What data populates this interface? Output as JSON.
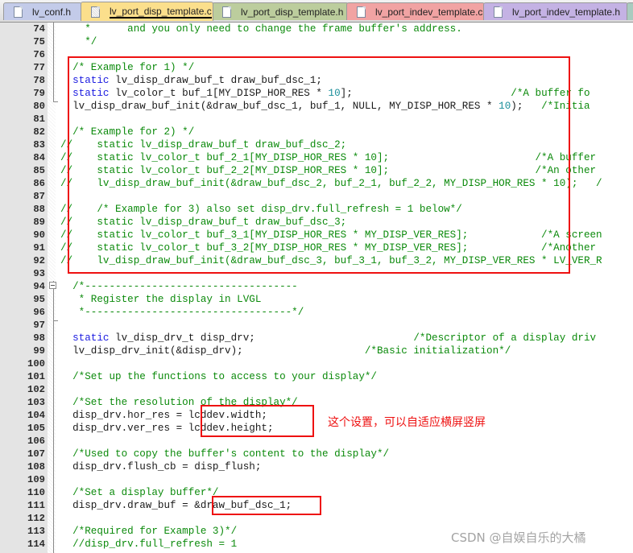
{
  "tabs": [
    {
      "label": "lv_conf.h",
      "active": false,
      "color": "#c3cbe9"
    },
    {
      "label": "lv_port_disp_template.c",
      "active": true,
      "color": "#fbdf8c"
    },
    {
      "label": "lv_port_disp_template.h",
      "active": false,
      "color": "#bccd9d"
    },
    {
      "label": "lv_port_indev_template.c",
      "active": false,
      "color": "#f1a3a3"
    },
    {
      "label": "lv_port_indev_template.h",
      "active": false,
      "color": "#c4b2e4"
    }
  ],
  "editor": {
    "lines": [
      {
        "n": "74",
        "segs": [
          [
            "cm",
            "    *      and you only need to change the frame buffer's address."
          ]
        ]
      },
      {
        "n": "75",
        "segs": [
          [
            "cm",
            "    */"
          ]
        ]
      },
      {
        "n": "76",
        "segs": []
      },
      {
        "n": "77",
        "segs": [
          [
            "cm",
            "  /* Example for 1) */"
          ]
        ]
      },
      {
        "n": "78",
        "segs": [
          [
            "kw",
            "  static"
          ],
          [
            "",
            " lv_disp_draw_buf_t draw_buf_dsc_1;"
          ]
        ]
      },
      {
        "n": "79",
        "segs": [
          [
            "kw",
            "  static"
          ],
          [
            "",
            " lv_color_t buf_1[MY_DISP_HOR_RES * "
          ],
          [
            "num",
            "10"
          ],
          [
            "",
            "];                          "
          ],
          [
            "cm",
            "/*A buffer fo"
          ]
        ]
      },
      {
        "n": "80",
        "segs": [
          [
            "",
            "  lv_disp_draw_buf_init(&draw_buf_dsc_1, buf_1, NULL, MY_DISP_HOR_RES * "
          ],
          [
            "num",
            "10"
          ],
          [
            "",
            ");   "
          ],
          [
            "cm",
            "/*Initia"
          ]
        ]
      },
      {
        "n": "81",
        "segs": []
      },
      {
        "n": "82",
        "segs": [
          [
            "cm",
            "  /* Example for 2) */"
          ]
        ]
      },
      {
        "n": "83",
        "segs": [
          [
            "disabled",
            "//    static lv_disp_draw_buf_t draw_buf_dsc_2;"
          ]
        ]
      },
      {
        "n": "84",
        "segs": [
          [
            "disabled",
            "//    static lv_color_t buf_2_1[MY_DISP_HOR_RES * 10];                        /*A buffer"
          ]
        ]
      },
      {
        "n": "85",
        "segs": [
          [
            "disabled",
            "//    static lv_color_t buf_2_2[MY_DISP_HOR_RES * 10];                        /*An other"
          ]
        ]
      },
      {
        "n": "86",
        "segs": [
          [
            "disabled",
            "//    lv_disp_draw_buf_init(&draw_buf_dsc_2, buf_2_1, buf_2_2, MY_DISP_HOR_RES * 10);   /"
          ]
        ]
      },
      {
        "n": "87",
        "segs": []
      },
      {
        "n": "88",
        "segs": [
          [
            "disabled",
            "//    /* Example for 3) also set disp_drv.full_refresh = 1 below*/"
          ]
        ]
      },
      {
        "n": "89",
        "segs": [
          [
            "disabled",
            "//    static lv_disp_draw_buf_t draw_buf_dsc_3;"
          ]
        ]
      },
      {
        "n": "90",
        "segs": [
          [
            "disabled",
            "//    static lv_color_t buf_3_1[MY_DISP_HOR_RES * MY_DISP_VER_RES];            /*A screen"
          ]
        ]
      },
      {
        "n": "91",
        "segs": [
          [
            "disabled",
            "//    static lv_color_t buf_3_2[MY_DISP_HOR_RES * MY_DISP_VER_RES];            /*Another"
          ]
        ]
      },
      {
        "n": "92",
        "segs": [
          [
            "disabled",
            "//    lv_disp_draw_buf_init(&draw_buf_dsc_3, buf_3_1, buf_3_2, MY_DISP_VER_RES * LV_VER_R"
          ]
        ]
      },
      {
        "n": "93",
        "segs": []
      },
      {
        "n": "94",
        "segs": [
          [
            "cm",
            "  /*-----------------------------------"
          ]
        ]
      },
      {
        "n": "95",
        "segs": [
          [
            "cm",
            "   * Register the display in LVGL"
          ]
        ]
      },
      {
        "n": "96",
        "segs": [
          [
            "cm",
            "   *----------------------------------*/"
          ]
        ]
      },
      {
        "n": "97",
        "segs": []
      },
      {
        "n": "98",
        "segs": [
          [
            "kw",
            "  static"
          ],
          [
            "",
            " lv_disp_drv_t disp_drv;                          "
          ],
          [
            "cm",
            "/*Descriptor of a display driv"
          ]
        ]
      },
      {
        "n": "99",
        "segs": [
          [
            "",
            "  lv_disp_drv_init(&disp_drv);                    "
          ],
          [
            "cm",
            "/*Basic initialization*/"
          ]
        ]
      },
      {
        "n": "100",
        "segs": []
      },
      {
        "n": "101",
        "segs": [
          [
            "cm",
            "  /*Set up the functions to access to your display*/"
          ]
        ]
      },
      {
        "n": "102",
        "segs": []
      },
      {
        "n": "103",
        "segs": [
          [
            "cm",
            "  /*Set the resolution of the display*/"
          ]
        ]
      },
      {
        "n": "104",
        "segs": [
          [
            "",
            "  disp_drv.hor_res = lcddev.width;"
          ]
        ]
      },
      {
        "n": "105",
        "segs": [
          [
            "",
            "  disp_drv.ver_res = lcddev.height;"
          ]
        ]
      },
      {
        "n": "106",
        "segs": []
      },
      {
        "n": "107",
        "segs": [
          [
            "cm",
            "  /*Used to copy the buffer's content to the display*/"
          ]
        ]
      },
      {
        "n": "108",
        "segs": [
          [
            "",
            "  disp_drv.flush_cb = disp_flush;"
          ]
        ]
      },
      {
        "n": "109",
        "segs": []
      },
      {
        "n": "110",
        "segs": [
          [
            "cm",
            "  /*Set a display buffer*/"
          ]
        ]
      },
      {
        "n": "111",
        "segs": [
          [
            "",
            "  disp_drv.draw_buf = &draw_buf_dsc_1;"
          ]
        ]
      },
      {
        "n": "112",
        "segs": []
      },
      {
        "n": "113",
        "segs": [
          [
            "cm",
            "  /*Required for Example 3)*/"
          ]
        ]
      },
      {
        "n": "114",
        "segs": [
          [
            "cm",
            "  //disp_drv.full_refresh = 1"
          ]
        ]
      }
    ]
  },
  "annotation": {
    "text": "这个设置，可以自适应横屏竖屏",
    "color": "#ee1111"
  },
  "watermark": "CSDN @自娱自乐的大橘"
}
